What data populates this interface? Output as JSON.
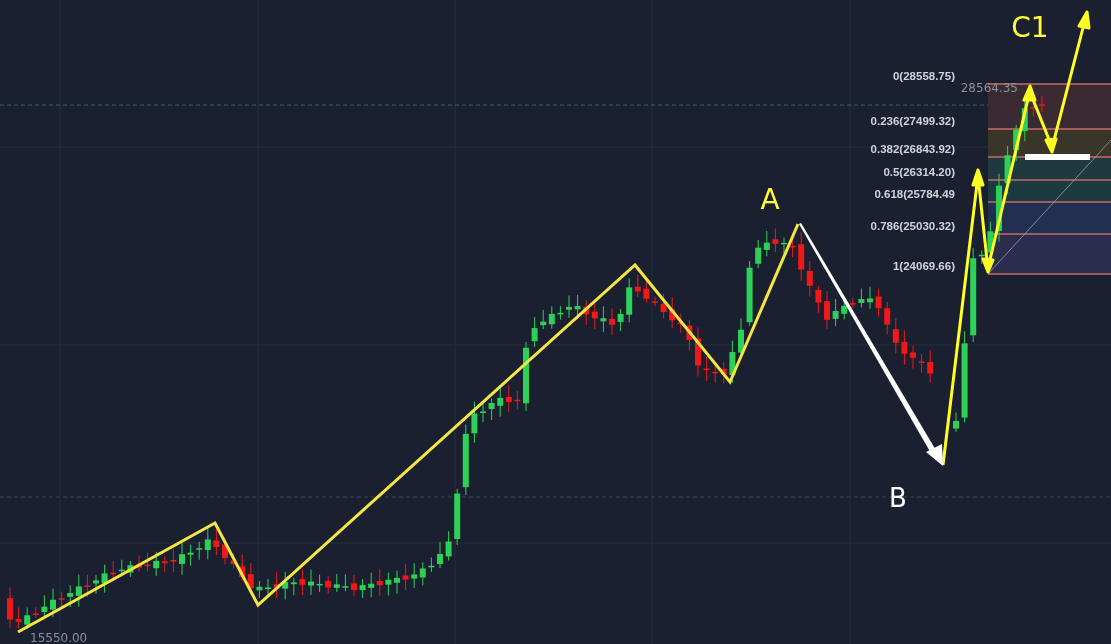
{
  "fibonacci": {
    "levels": [
      {
        "label": "0(28558.75)"
      },
      {
        "label": "0.236(27499.32)"
      },
      {
        "label": "0.382(26843.92)"
      },
      {
        "label": "0.5(26314.20)"
      },
      {
        "label": "0.618(25784.49"
      },
      {
        "label": "0.786(25030.32)"
      },
      {
        "label": "1(24069.66)"
      }
    ]
  },
  "price_labels": {
    "current": "28564.35",
    "low": "15550.00"
  },
  "wave_labels": [
    {
      "text": "A",
      "color": "#ffff33"
    },
    {
      "text": "B",
      "color": "#ffffff"
    },
    {
      "text": "C1",
      "color": "#ffff33"
    }
  ]
}
